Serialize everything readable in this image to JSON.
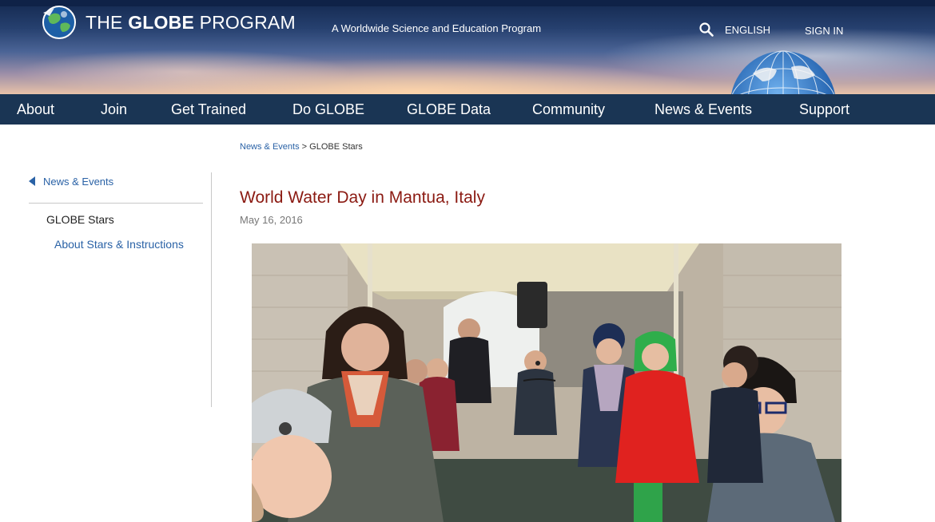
{
  "header": {
    "brand_prefix": "THE ",
    "brand_bold": "GLOBE",
    "brand_suffix": " PROGRAM",
    "tagline": "A Worldwide Science and Education Program",
    "language": "ENGLISH",
    "sign_in": "SIGN IN",
    "search_icon": "search-icon"
  },
  "nav": {
    "items": [
      "About",
      "Join",
      "Get Trained",
      "Do GLOBE",
      "GLOBE Data",
      "Community",
      "News & Events",
      "Support"
    ]
  },
  "breadcrumb": {
    "parent": "News & Events",
    "separator": " > ",
    "current": "GLOBE Stars"
  },
  "sidebar": {
    "back_label": "News & Events",
    "current": "GLOBE Stars",
    "sub_item": "About Stars & Instructions"
  },
  "article": {
    "title": "World Water Day in Mantua, Italy",
    "date": "May 16, 2016"
  },
  "colors": {
    "nav_bg": "#1a3554",
    "link": "#2a62a6",
    "title": "#8b1a12"
  }
}
